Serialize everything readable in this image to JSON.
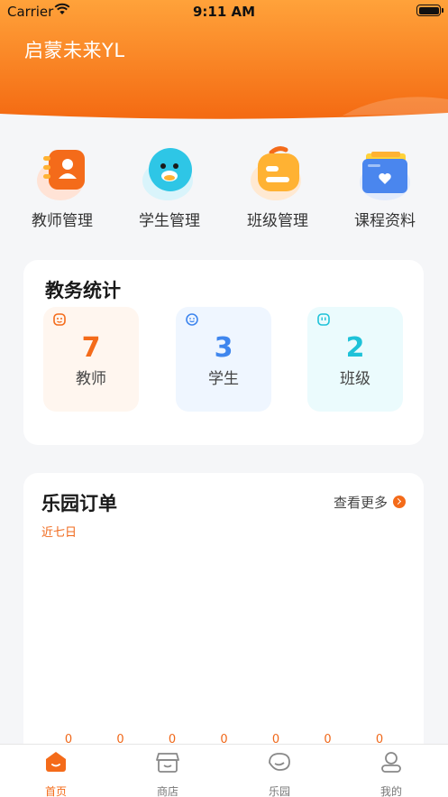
{
  "status_bar": {
    "carrier": "Carrier",
    "time": "9:11 AM"
  },
  "header": {
    "school_name": "启蒙未来YL"
  },
  "quick_menu": [
    {
      "label": "教师管理",
      "icon": "teacher-card-icon"
    },
    {
      "label": "学生管理",
      "icon": "student-face-icon"
    },
    {
      "label": "班级管理",
      "icon": "class-icon"
    },
    {
      "label": "课程资料",
      "icon": "course-folder-icon"
    }
  ],
  "stats": {
    "title": "教务统计",
    "items": [
      {
        "value": "7",
        "label": "教师"
      },
      {
        "value": "3",
        "label": "学生"
      },
      {
        "value": "2",
        "label": "班级"
      }
    ]
  },
  "orders": {
    "title": "乐园订单",
    "more_label": "查看更多",
    "range_label": "近七日",
    "chart_data": {
      "type": "bar",
      "values": [
        0,
        0,
        0,
        0,
        0,
        0,
        0
      ]
    }
  },
  "tabbar": [
    {
      "label": "首页",
      "active": true
    },
    {
      "label": "商店",
      "active": false
    },
    {
      "label": "乐园",
      "active": false
    },
    {
      "label": "我的",
      "active": false
    }
  ],
  "colors": {
    "brand": "#f46b1a",
    "brand_light": "#ffa53a"
  }
}
